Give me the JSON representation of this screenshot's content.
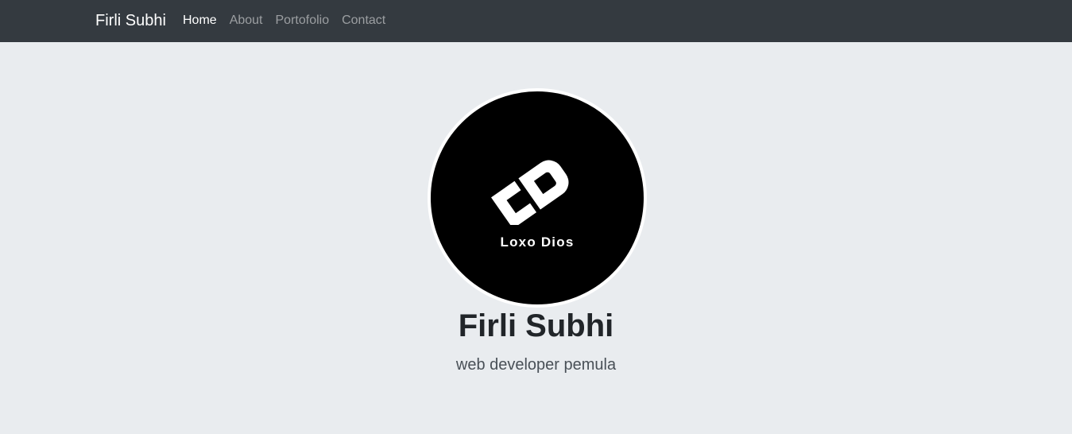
{
  "navbar": {
    "brand": "Firli Subhi",
    "links": [
      {
        "label": "Home",
        "active": true
      },
      {
        "label": "About",
        "active": false
      },
      {
        "label": "Portofolio",
        "active": false
      },
      {
        "label": "Contact",
        "active": false
      }
    ]
  },
  "hero": {
    "avatar_logo_text": "Loxo Dios",
    "name": "Firli Subhi",
    "tagline": "web developer pemula"
  },
  "colors": {
    "navbar_bg": "#343a40",
    "page_bg": "#e9ecef",
    "text_dark": "#212529"
  }
}
